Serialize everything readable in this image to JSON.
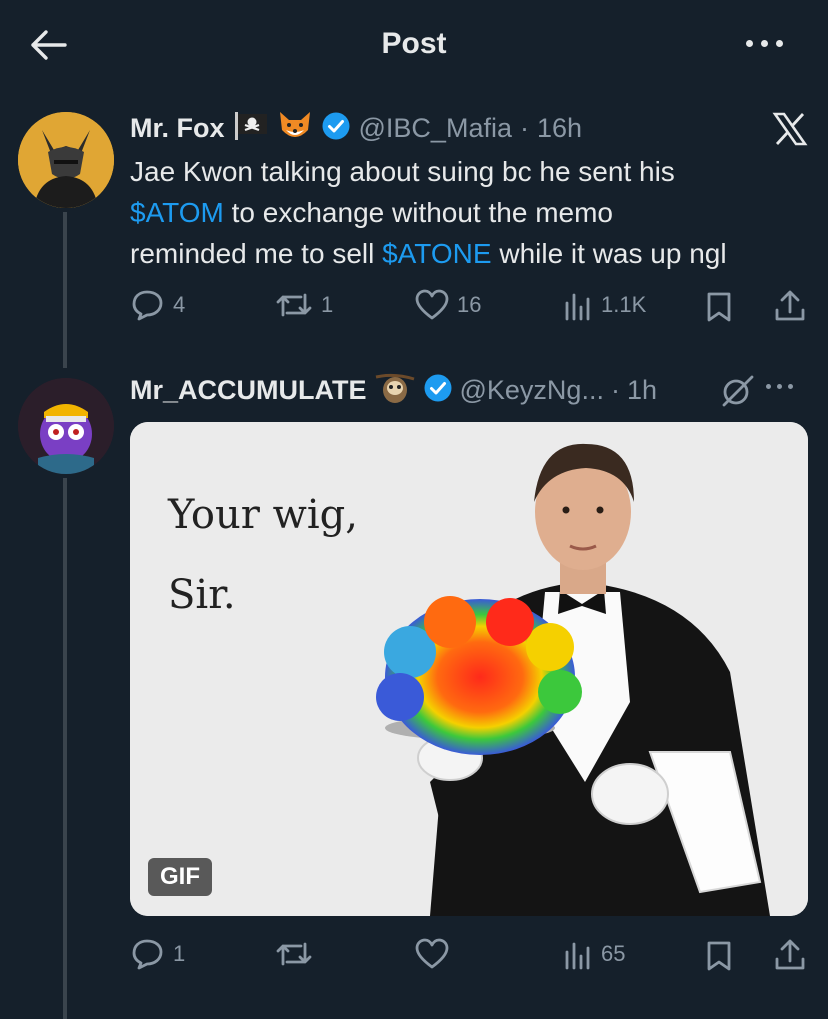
{
  "header": {
    "title": "Post"
  },
  "post": {
    "author_name": "Mr. Fox",
    "handle": "@IBC_Mafia",
    "separator": "·",
    "time": "16h",
    "text_part1": "Jae Kwon talking about suing bc he sent his",
    "cashtag1": "$ATOM",
    "text_part2": " to exchange without the memo",
    "text_part3": "reminded me to sell ",
    "cashtag2": "$ATONE",
    "text_part4": " while it was up ngl",
    "replies": "4",
    "reposts": "1",
    "likes": "16",
    "views": "1.1K"
  },
  "reply": {
    "author_name": "Mr_ACCUMULATE",
    "handle": "@KeyzNg...",
    "separator": "·",
    "time": "1h",
    "media_text_line1": "Your wig,",
    "media_text_line2": "Sir.",
    "media_badge": "GIF",
    "replies": "1",
    "views": "65"
  },
  "colors": {
    "background": "#15202b",
    "accent": "#1d9bf0",
    "muted": "#8b98a5",
    "text": "#e7e9ea"
  },
  "icons": [
    "back-arrow-icon",
    "more-icon",
    "pirate-flag-icon",
    "fox-emoji-icon",
    "verified-badge-icon",
    "x-logo-icon",
    "reply-icon",
    "repost-icon",
    "like-icon",
    "views-icon",
    "bookmark-icon",
    "share-icon",
    "sloth-emoji-icon",
    "grok-icon"
  ]
}
